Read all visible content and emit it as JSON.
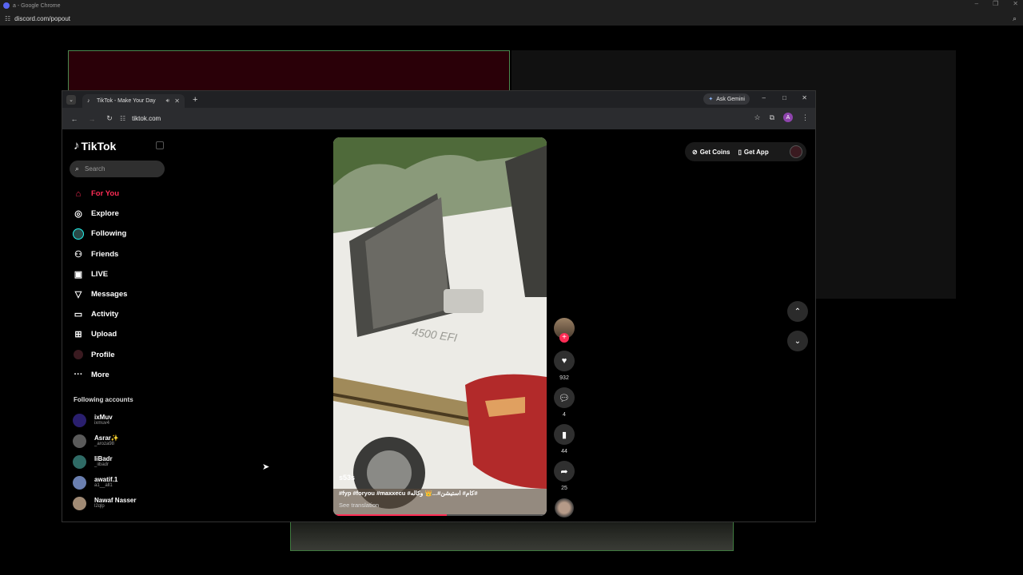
{
  "outer": {
    "title": "a - Google Chrome",
    "url": "discord.com/popout"
  },
  "chrome": {
    "tab_title": "TikTok - Make Your Day",
    "gemini": "Ask Gemini",
    "url": "tiktok.com",
    "profile_initial": "A"
  },
  "tiktok": {
    "logo": "TikTok",
    "search_placeholder": "Search",
    "nav": [
      {
        "label": "For You",
        "icon": "home-icon"
      },
      {
        "label": "Explore",
        "icon": "compass-icon"
      },
      {
        "label": "Following",
        "icon": "following-avatar-icon"
      },
      {
        "label": "Friends",
        "icon": "friends-icon"
      },
      {
        "label": "LIVE",
        "icon": "live-icon"
      },
      {
        "label": "Messages",
        "icon": "messages-icon"
      },
      {
        "label": "Activity",
        "icon": "activity-icon"
      },
      {
        "label": "Upload",
        "icon": "upload-icon"
      },
      {
        "label": "Profile",
        "icon": "profile-avatar-icon"
      },
      {
        "label": "More",
        "icon": "more-icon"
      }
    ],
    "following_heading": "Following accounts",
    "accounts": [
      {
        "name": "ixMuv",
        "handle": "ixmuv4",
        "color": "#2a1f6e"
      },
      {
        "name": "Asrar✨",
        "handle": "_aroza98",
        "color": "#5a5a5a"
      },
      {
        "name": "IiBadr",
        "handle": "_iibadr",
        "color": "#2f6b66"
      },
      {
        "name": "awatif.1",
        "handle": "a1__all1",
        "color": "#6a7fb0"
      },
      {
        "name": "Nawaf Nasser",
        "handle": "l2qlp",
        "color": "#a08a74"
      }
    ],
    "video": {
      "username": "s53s",
      "caption": "#fyp #foryou #maxxecu #كام# استيشن#...👑 وكاله#",
      "translate": "See translation",
      "progress": 0.53
    },
    "actions": {
      "likes": "932",
      "comments": "4",
      "saves": "44",
      "shares": "25"
    },
    "get_coins": "Get Coins",
    "get_app": "Get App"
  }
}
